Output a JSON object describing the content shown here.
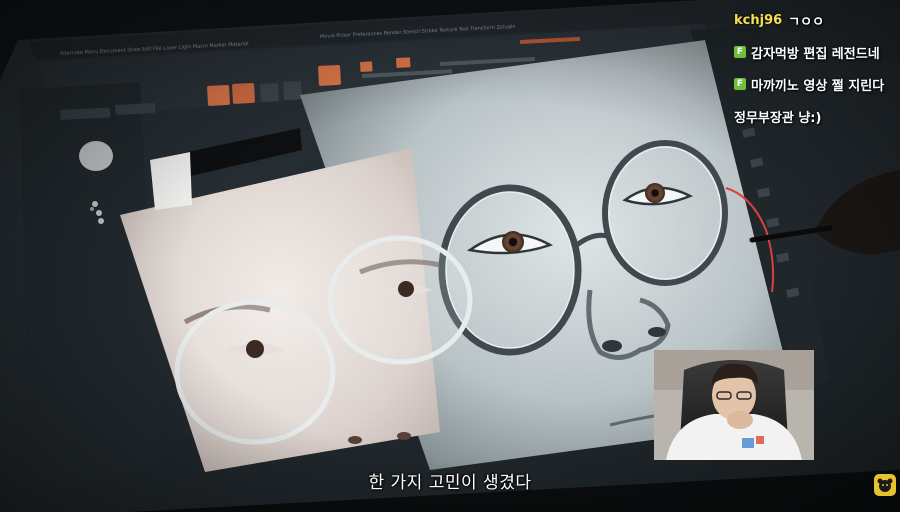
{
  "chat": {
    "messages": [
      {
        "user": "kchj96",
        "text": "ㄱㅇㅇ",
        "badge": false
      },
      {
        "user": "",
        "text": "감자먹방 편집 레전드네",
        "badge": true,
        "badge_text": "F"
      },
      {
        "user": "",
        "text": "마까끼노 영상 쩔 지린다",
        "badge": true,
        "badge_text": "F"
      },
      {
        "user": "",
        "text": "정무부장관 냥:)",
        "badge": false
      }
    ]
  },
  "subtitle": "한 가지 고민이 생겼다",
  "colors": {
    "chat_user": "#f4e04d",
    "badge": "#6fbf3a",
    "subtitle": "#ffffff",
    "ui_accent": "#e0784a"
  }
}
